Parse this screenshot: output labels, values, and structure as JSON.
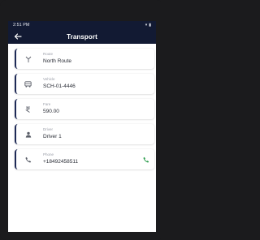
{
  "status": {
    "time": "2:51",
    "ampm": "PM"
  },
  "header": {
    "title": "Transport"
  },
  "fields": [
    {
      "label": "Route",
      "value": "North Route",
      "icon": "route-icon"
    },
    {
      "label": "Vehicle",
      "value": "SCH-01-4446",
      "icon": "bus-icon"
    },
    {
      "label": "Fare",
      "value": "590.00",
      "icon": "rupee-icon"
    },
    {
      "label": "Driver",
      "value": "Driver 1",
      "icon": "person-icon"
    },
    {
      "label": "Phone",
      "value": "+18492458511",
      "icon": "phone-icon",
      "action": "call-icon"
    }
  ],
  "colors": {
    "appbar": "#121a33",
    "accent": "#1e2a56",
    "call": "#2e9e4f"
  }
}
